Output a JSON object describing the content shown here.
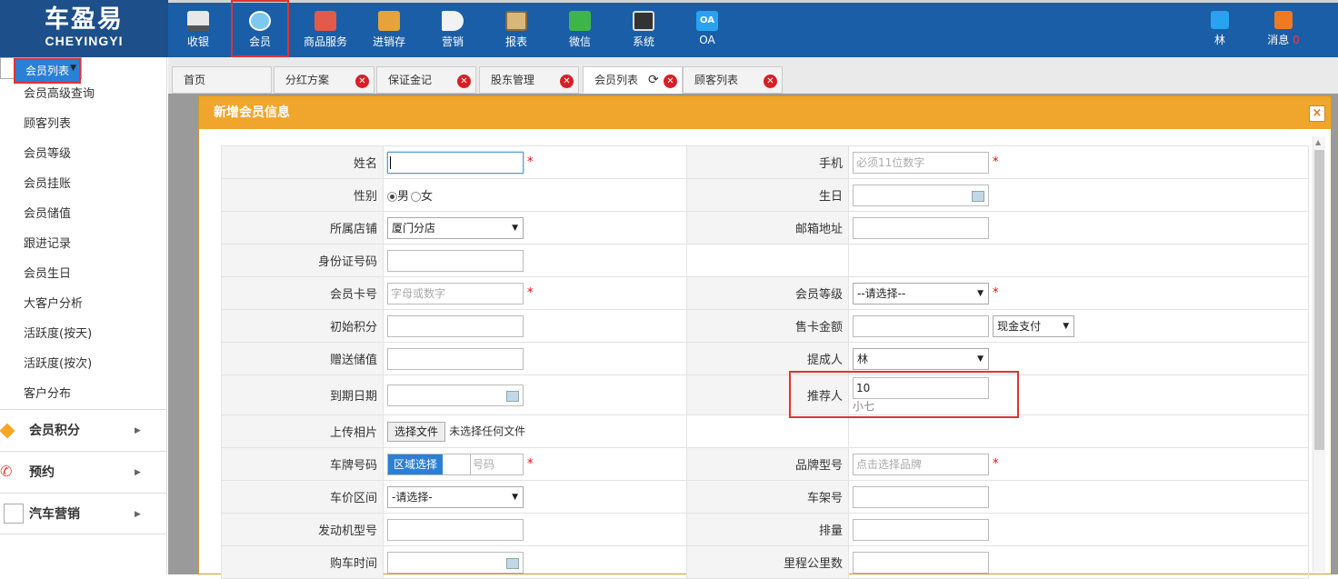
{
  "logo": {
    "line1": "车盈易",
    "line2": "CHEYINGYI"
  },
  "nav": [
    {
      "label": "收银",
      "icon": "cashier-icon"
    },
    {
      "label": "会员",
      "icon": "member-icon"
    },
    {
      "label": "商品服务",
      "icon": "goods-icon"
    },
    {
      "label": "进销存",
      "icon": "inventory-icon"
    },
    {
      "label": "营销",
      "icon": "megaphone-icon"
    },
    {
      "label": "报表",
      "icon": "report-icon"
    },
    {
      "label": "微信",
      "icon": "wechat-icon"
    },
    {
      "label": "系统",
      "icon": "monitor-icon"
    },
    {
      "label": "OA",
      "icon": "oa-icon"
    }
  ],
  "user": {
    "name": "林",
    "messages_label": "消息",
    "messages_count": "0"
  },
  "sidebar": {
    "items": [
      "会员列表",
      "会员高级查询",
      "顾客列表",
      "会员等级",
      "会员挂账",
      "会员储值",
      "跟进记录",
      "会员生日",
      "大客户分析",
      "活跃度(按天)",
      "活跃度(按次)",
      "客户分布"
    ],
    "groups": [
      "会员积分",
      "预约",
      "汽车营销"
    ]
  },
  "tabs": [
    "首页",
    "分红方案",
    "保证金记",
    "股东管理",
    "会员列表",
    "顾客列表"
  ],
  "modal": {
    "title": "新增会员信息",
    "close": "×",
    "fields": {
      "name_label": "姓名",
      "phone_label": "手机",
      "phone_placeholder": "必须11位数字",
      "gender_label": "性别",
      "gender_male": "男",
      "gender_female": "女",
      "birthday_label": "生日",
      "store_label": "所属店铺",
      "store_value": "厦门分店",
      "email_label": "邮箱地址",
      "idcard_label": "身份证号码",
      "card_label": "会员卡号",
      "card_placeholder": "字母或数字",
      "level_label": "会员等级",
      "level_value": "--请选择--",
      "points_label": "初始积分",
      "sale_amount_label": "售卡金额",
      "pay_method": "现金支付",
      "gift_label": "赠送储值",
      "promoter_label": "提成人",
      "promoter_value": "林",
      "expire_label": "到期日期",
      "referrer_label": "推荐人",
      "referrer_value": "10",
      "referrer_hint": "小七",
      "photo_label": "上传相片",
      "photo_button": "选择文件",
      "photo_status": "未选择任何文件",
      "plate_label": "车牌号码",
      "plate_region": "区域选择",
      "plate_placeholder": "号码",
      "brand_label": "品牌型号",
      "brand_placeholder": "点击选择品牌",
      "price_label": "车价区间",
      "price_value": "-请选择-",
      "vin_label": "车架号",
      "engine_label": "发动机型号",
      "displacement_label": "排量",
      "buy_date_label": "购车时间",
      "mileage_label": "里程公里数"
    }
  }
}
